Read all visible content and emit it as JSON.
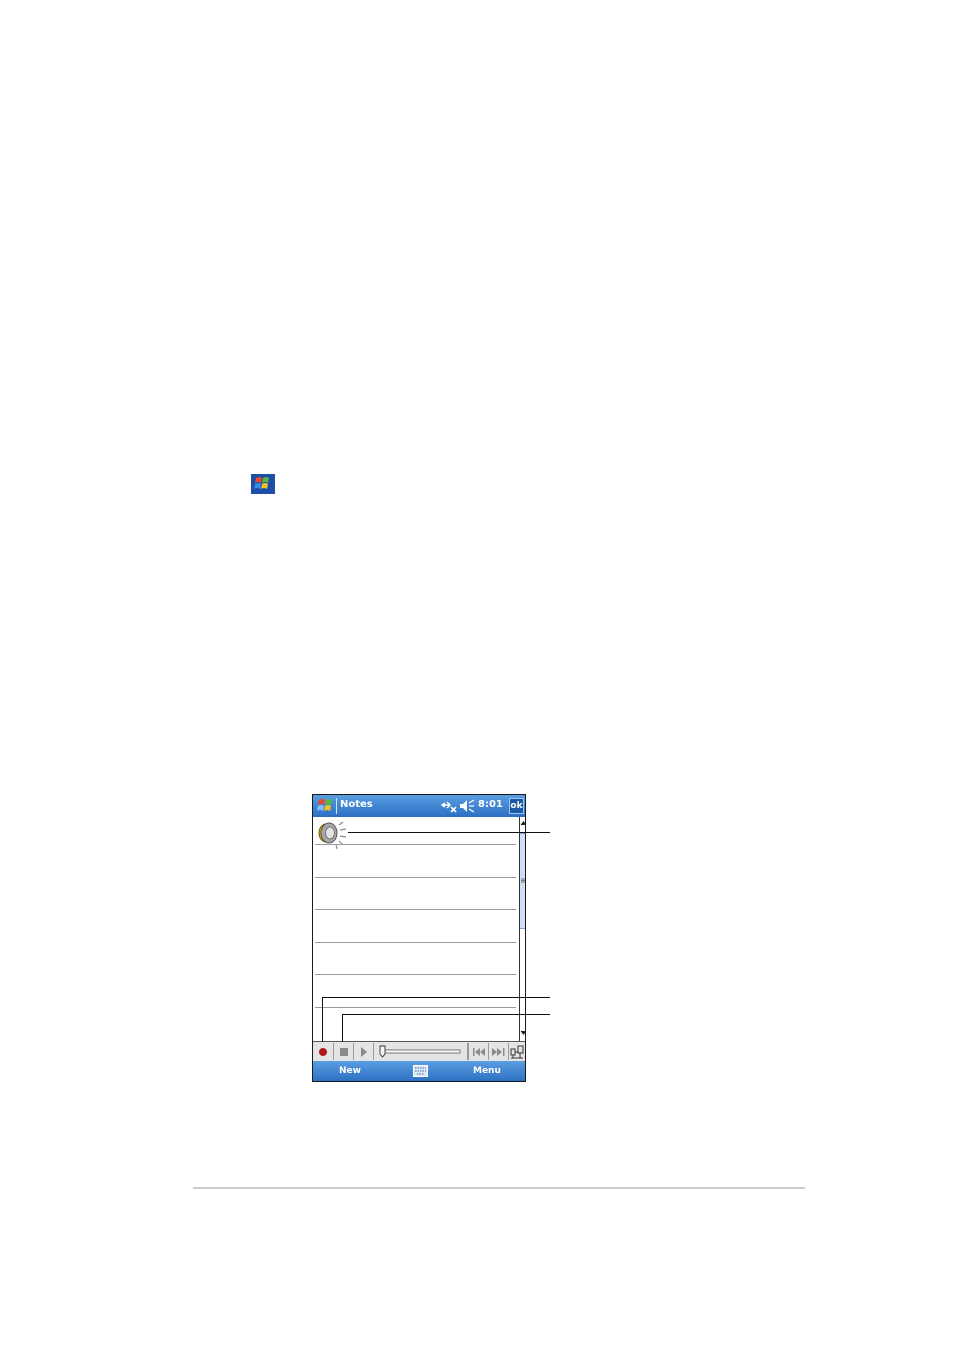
{
  "device": {
    "title": "Notes",
    "time": "8:01",
    "ok_label": "ok",
    "status_icons": [
      "connectivity-icon",
      "speaker-muted-icon"
    ],
    "menubar": {
      "left_label": "New",
      "right_label": "Menu",
      "center_icon": "keyboard-icon"
    },
    "recording_toolbar": [
      "record",
      "stop",
      "play",
      "volume-slider",
      "previous",
      "next",
      "network"
    ]
  },
  "colors": {
    "titlebar": "#2b6fc4",
    "record": "#b01818",
    "rule": "#9a9a9a"
  }
}
